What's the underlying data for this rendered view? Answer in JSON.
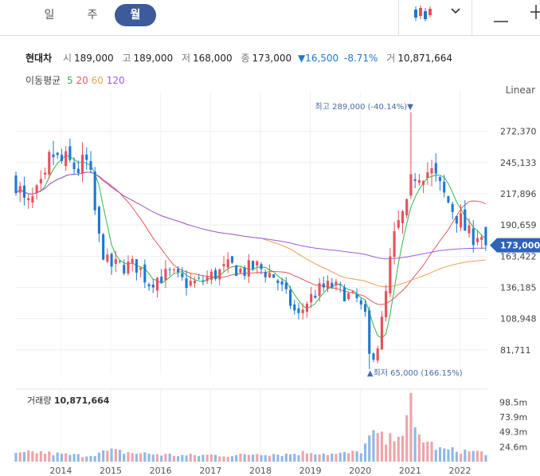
{
  "tabs": [
    {
      "label": "일",
      "active": false
    },
    {
      "label": "주",
      "active": false
    },
    {
      "label": "월",
      "active": true
    }
  ],
  "toolbar": {
    "chart_type_icon": "candlestick-icon",
    "dropdown_icon": "chevron-down-icon",
    "minus_icon": "minus-icon",
    "plus_icon": "plus-icon"
  },
  "quote": {
    "name": "현대차",
    "open_label": "시",
    "open": "189,000",
    "high_label": "고",
    "high": "189,000",
    "low_label": "저",
    "low": "168,000",
    "close_label": "종",
    "close": "173,000",
    "change": "▼16,500",
    "change_pct": "-8.71%",
    "volume_label": "거",
    "volume": "10,871,664"
  },
  "ma_legend": {
    "label": "이동평균",
    "items": [
      {
        "text": "5",
        "color": "#2fb84a"
      },
      {
        "text": "20",
        "color": "#e35b5b"
      },
      {
        "text": "60",
        "color": "#f0a050"
      },
      {
        "text": "120",
        "color": "#9a5ee0"
      }
    ]
  },
  "scale_label": "Linear",
  "colors": {
    "up": "#e8505b",
    "down": "#1f78d1",
    "ma5": "#2fb84a",
    "ma20": "#e35b5b",
    "ma60": "#f0a050",
    "ma120": "#9a5ee0",
    "price_tag": "#2e63b8"
  },
  "chart_data": [
    {
      "type": "candlestick",
      "ylim": [
        60000,
        300000
      ],
      "y_ticks": [
        272370,
        245133,
        217896,
        190659,
        163422,
        136185,
        108948,
        81711
      ],
      "y_tick_labels": [
        "272,370",
        "245,133",
        "217,896",
        "190,659",
        "163,422",
        "136,185",
        "108,948",
        "81,711"
      ],
      "x_ticks": [
        "2014",
        "2015",
        "2016",
        "2017",
        "2018",
        "2019",
        "2020",
        "2021",
        "2022"
      ],
      "x_range": [
        2013.1,
        2022.55
      ],
      "price_annotations": {
        "high_label": "최고 289,000 (-40.14%)",
        "high_value": 289000,
        "high_x": 2021.0,
        "low_label": "최저 65,000 (166.15%)",
        "low_value": 65000,
        "low_x": 2020.17
      },
      "last_price_tag": {
        "value": 173000,
        "label": "173,000"
      },
      "ohlc_anchor_closes": [
        [
          2013.1,
          230000
        ],
        [
          2013.3,
          205000
        ],
        [
          2013.5,
          215000
        ],
        [
          2013.7,
          228000
        ],
        [
          2013.8,
          255000
        ],
        [
          2013.95,
          245000
        ],
        [
          2014.1,
          245000
        ],
        [
          2014.35,
          240000
        ],
        [
          2014.55,
          245000
        ],
        [
          2014.75,
          180000
        ],
        [
          2014.95,
          155000
        ],
        [
          2015.1,
          155000
        ],
        [
          2015.3,
          155000
        ],
        [
          2015.55,
          155000
        ],
        [
          2015.75,
          140000
        ],
        [
          2015.95,
          145000
        ],
        [
          2016.2,
          148000
        ],
        [
          2016.5,
          140000
        ],
        [
          2016.75,
          140000
        ],
        [
          2016.95,
          145000
        ],
        [
          2017.2,
          150000
        ],
        [
          2017.4,
          155000
        ],
        [
          2017.65,
          150000
        ],
        [
          2017.9,
          155000
        ],
        [
          2018.1,
          150000
        ],
        [
          2018.3,
          145000
        ],
        [
          2018.5,
          130000
        ],
        [
          2018.75,
          110000
        ],
        [
          2018.95,
          125000
        ],
        [
          2019.2,
          135000
        ],
        [
          2019.45,
          138000
        ],
        [
          2019.7,
          130000
        ],
        [
          2019.95,
          125000
        ],
        [
          2020.1,
          110000
        ],
        [
          2020.2,
          70000
        ],
        [
          2020.35,
          85000
        ],
        [
          2020.5,
          125000
        ],
        [
          2020.65,
          175000
        ],
        [
          2020.8,
          195000
        ],
        [
          2020.95,
          205000
        ],
        [
          2021.05,
          235000
        ],
        [
          2021.25,
          240000
        ],
        [
          2021.45,
          235000
        ],
        [
          2021.65,
          218000
        ],
        [
          2021.85,
          205000
        ],
        [
          2022.0,
          195000
        ],
        [
          2022.2,
          180000
        ],
        [
          2022.4,
          185000
        ],
        [
          2022.5,
          173000
        ]
      ],
      "volume": {
        "label": "거래량",
        "value": "10,871,664",
        "y_ticks": [
          98.5,
          73.9,
          49.3,
          24.6
        ],
        "y_tick_labels": [
          "98.5m",
          "73.9m",
          "49.3m",
          "24.6m"
        ],
        "unit": "millions",
        "ylim": [
          0,
          120
        ],
        "anchor_values": [
          [
            2013.1,
            12
          ],
          [
            2013.5,
            16
          ],
          [
            2014.0,
            12
          ],
          [
            2014.5,
            10
          ],
          [
            2015.0,
            18
          ],
          [
            2015.5,
            14
          ],
          [
            2016.0,
            12
          ],
          [
            2016.5,
            10
          ],
          [
            2017.0,
            11
          ],
          [
            2017.5,
            10
          ],
          [
            2018.0,
            14
          ],
          [
            2018.5,
            12
          ],
          [
            2019.0,
            16
          ],
          [
            2019.5,
            12
          ],
          [
            2020.0,
            16
          ],
          [
            2020.2,
            40
          ],
          [
            2020.35,
            45
          ],
          [
            2020.55,
            30
          ],
          [
            2020.75,
            55
          ],
          [
            2020.9,
            45
          ],
          [
            2021.0,
            100
          ],
          [
            2021.1,
            50
          ],
          [
            2021.3,
            35
          ],
          [
            2021.6,
            20
          ],
          [
            2022.0,
            18
          ],
          [
            2022.5,
            15
          ]
        ]
      }
    }
  ]
}
